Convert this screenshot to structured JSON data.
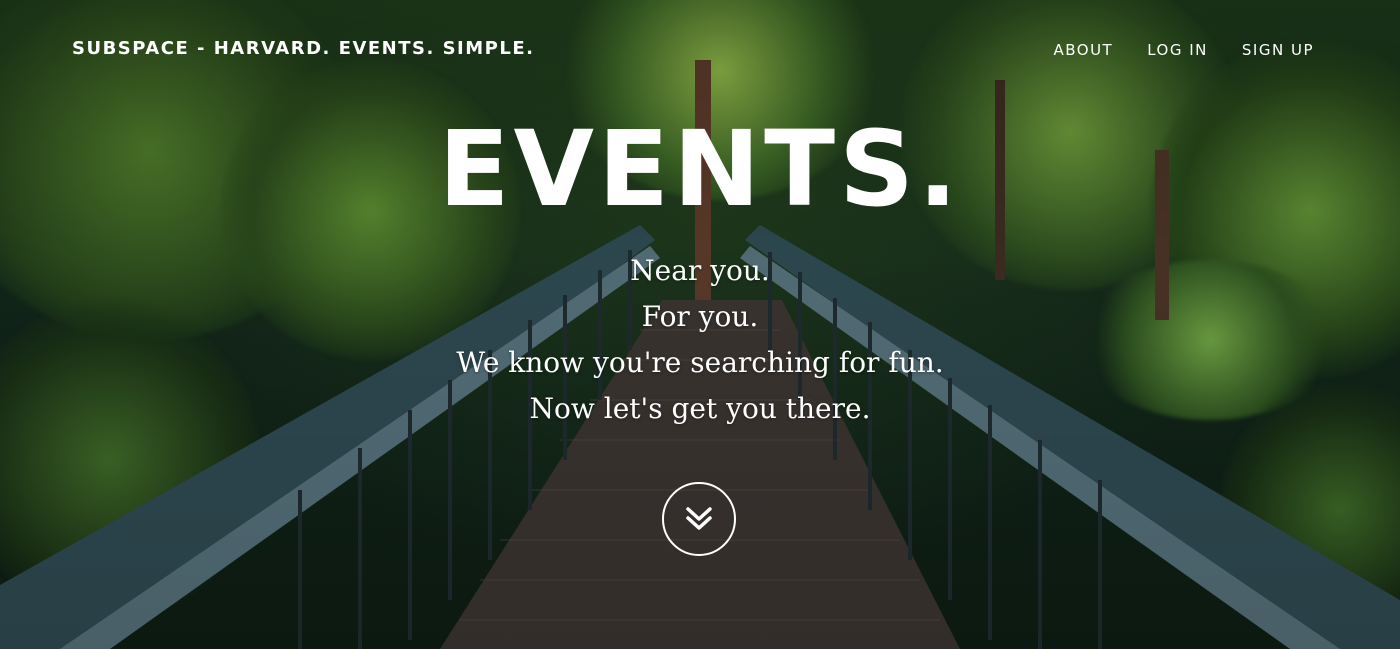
{
  "nav": {
    "brand": "SUBSPACE - HARVARD. EVENTS. SIMPLE.",
    "links": [
      {
        "label": "ABOUT"
      },
      {
        "label": "LOG IN"
      },
      {
        "label": "SIGN UP"
      }
    ]
  },
  "hero": {
    "headline": "EVENTS.",
    "tagline": [
      "Near you.",
      "For you.",
      "We know you're searching for fun.",
      "Now let's get you there."
    ],
    "scroll_icon": "double-chevron-down-icon",
    "background": "forest footbridge photo"
  },
  "colors": {
    "text": "#ffffff",
    "railing": "#2f4a52",
    "deck": "#3a3430",
    "foliage": "#2c4a22"
  }
}
